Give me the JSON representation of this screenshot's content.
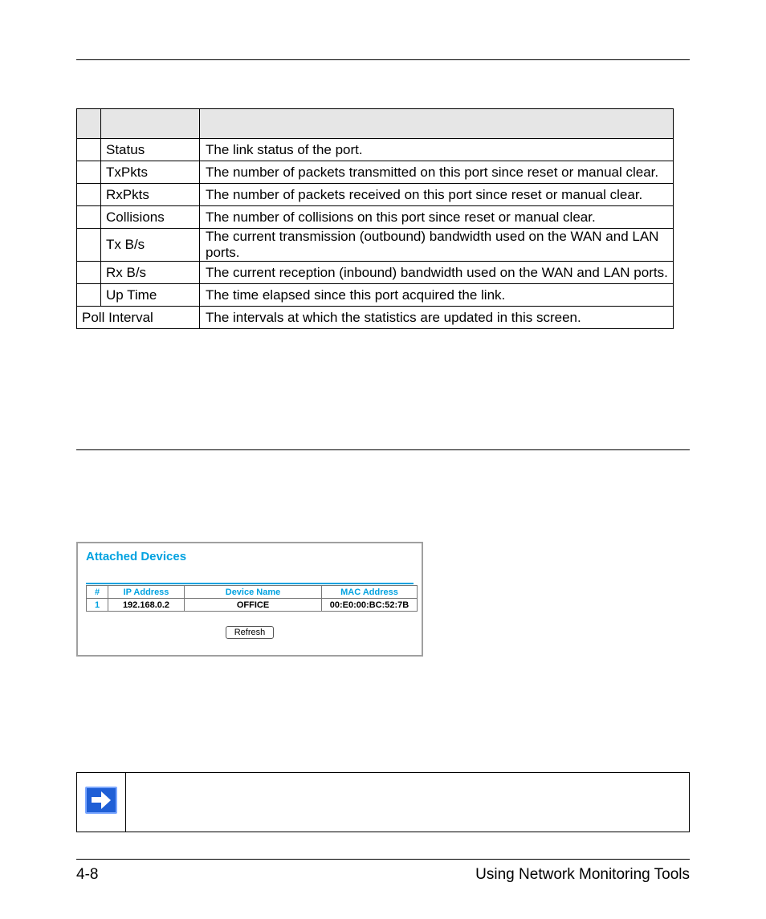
{
  "stats_rows": [
    {
      "label": "Status",
      "desc": "The link status of the port."
    },
    {
      "label": "TxPkts",
      "desc": "The number of packets transmitted on this port since reset or manual clear."
    },
    {
      "label": "RxPkts",
      "desc": "The number of packets received on this port since reset or manual clear."
    },
    {
      "label": "Collisions",
      "desc": "The number of collisions on this port since reset or manual clear."
    },
    {
      "label": "Tx B/s",
      "desc": "The current transmission (outbound) bandwidth used on the WAN and LAN ports."
    },
    {
      "label": "Rx B/s",
      "desc": "The current reception (inbound) bandwidth used on the WAN and LAN ports."
    },
    {
      "label": "Up Time",
      "desc": "The time elapsed since this port acquired the link."
    }
  ],
  "poll_row": {
    "label": "Poll Interval",
    "desc": "The intervals at which the statistics are updated in this screen."
  },
  "panel": {
    "title": "Attached Devices",
    "headers": [
      "#",
      "IP Address",
      "Device Name",
      "MAC Address"
    ],
    "row": {
      "idx": "1",
      "ip": "192.168.0.2",
      "name": "OFFICE",
      "mac": "00:E0:00:BC:52:7B"
    },
    "refresh": "Refresh"
  },
  "footer": {
    "left": "4-8",
    "right": "Using Network Monitoring Tools"
  }
}
